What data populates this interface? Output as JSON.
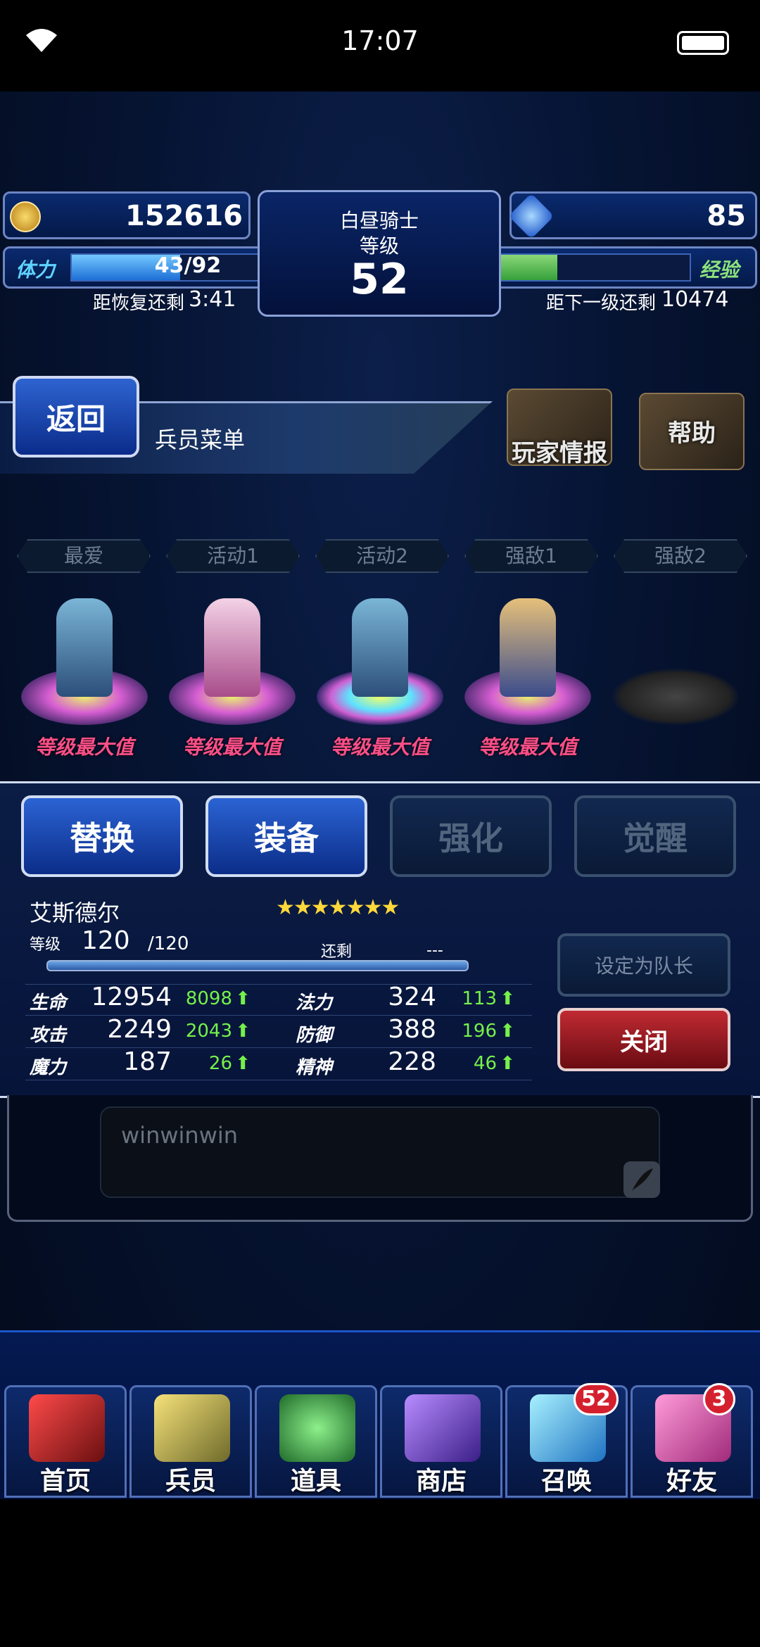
{
  "status_bar": {
    "time": "17:07"
  },
  "hud": {
    "coins": "152616",
    "gems": "85",
    "player_title": "白昼骑士",
    "level_label": "等级",
    "level": "52",
    "stamina_label": "体力",
    "stamina_current": "43",
    "stamina_max": "/92",
    "stamina_fraction": 0.467,
    "recover_label": "距恢复还剩",
    "recover_time": "3:41",
    "exp_label": "经验",
    "exp_fraction": 0.44,
    "next_level_label": "距下一级还剩",
    "next_level_value": "10474"
  },
  "header": {
    "back_label": "返回",
    "menu_title": "兵员菜单",
    "player_info_label": "玩家情报",
    "help_label": "帮助"
  },
  "party_tabs": [
    "最爱",
    "活动1",
    "活动2",
    "强敌1",
    "强敌2"
  ],
  "units": [
    {
      "status": "等级最大值"
    },
    {
      "status": "等级最大值"
    },
    {
      "status": "等级最大值"
    },
    {
      "status": "等级最大值"
    },
    {
      "status": ""
    }
  ],
  "actions": {
    "swap": "替换",
    "equip": "装备",
    "enhance": "强化",
    "awaken": "觉醒"
  },
  "unit_detail": {
    "name": "艾斯德尔",
    "stars": "★★★★★★★",
    "level_label": "等级",
    "level": "120",
    "level_max": "/120",
    "remain_label": "还剩",
    "remain_value": "---",
    "stats": [
      {
        "label": "生命",
        "value": "12954",
        "bonus": "8098"
      },
      {
        "label": "法力",
        "value": "324",
        "bonus": "113"
      },
      {
        "label": "攻击",
        "value": "2249",
        "bonus": "2043"
      },
      {
        "label": "防御",
        "value": "388",
        "bonus": "196"
      },
      {
        "label": "魔力",
        "value": "187",
        "bonus": "26"
      },
      {
        "label": "精神",
        "value": "228",
        "bonus": "46"
      }
    ],
    "set_leader_label": "设定为队长",
    "close_label": "关闭"
  },
  "comment": {
    "text": "winwinwin"
  },
  "nav": [
    {
      "label": "首页",
      "icon": "sword-icon"
    },
    {
      "label": "兵员",
      "icon": "hero-icon"
    },
    {
      "label": "道具",
      "icon": "potion-icon"
    },
    {
      "label": "商店",
      "icon": "shop-icon"
    },
    {
      "label": "召唤",
      "icon": "crystal-icon",
      "badge": "52"
    },
    {
      "label": "好友",
      "icon": "friends-icon",
      "badge": "3"
    }
  ],
  "colors": {
    "accent": "#1d6fd6",
    "bonus_green": "#75f14a",
    "max_pink": "#ff4f88",
    "close_red": "#c02a32"
  }
}
